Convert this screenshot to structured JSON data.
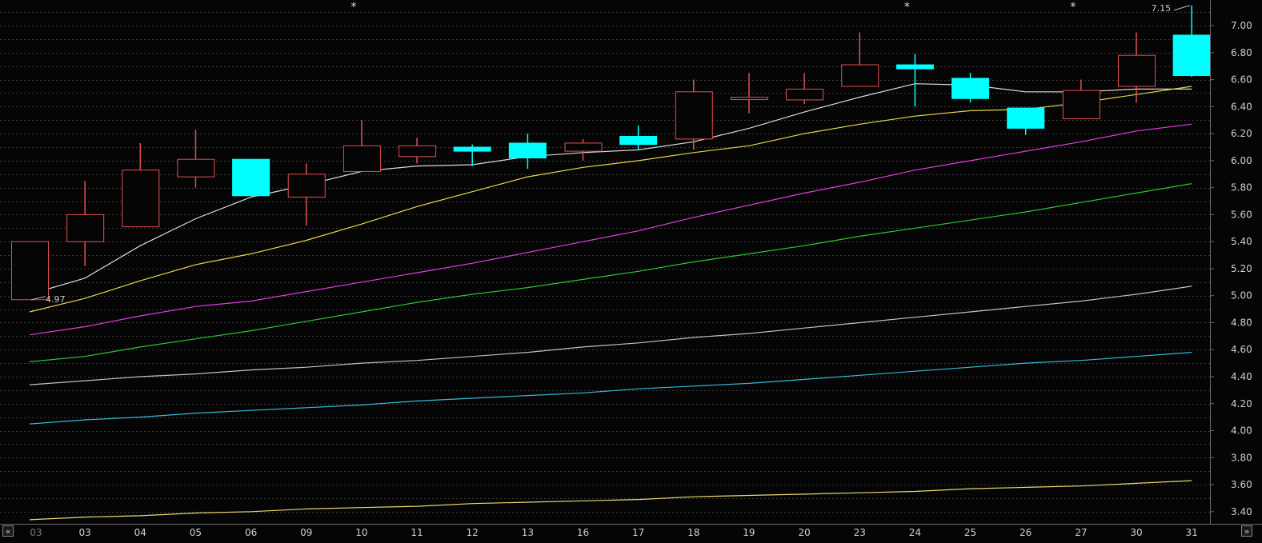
{
  "chart_data": {
    "type": "candlestick",
    "categories": [
      "03",
      "03",
      "04",
      "05",
      "06",
      "09",
      "10",
      "11",
      "12",
      "13",
      "16",
      "17",
      "18",
      "19",
      "20",
      "23",
      "24",
      "25",
      "26",
      "27",
      "30",
      "31"
    ],
    "first_label_dim": true,
    "y_ticks": [
      "3.40",
      "3.60",
      "3.80",
      "4.00",
      "4.20",
      "4.40",
      "4.60",
      "4.80",
      "5.00",
      "5.20",
      "5.40",
      "5.60",
      "5.80",
      "6.00",
      "6.20",
      "6.40",
      "6.60",
      "6.80",
      "7.00"
    ],
    "ylim": [
      3.31,
      7.19
    ],
    "grid": true,
    "candles": [
      {
        "o": 4.97,
        "h": 5.4,
        "l": 4.97,
        "c": 5.4
      },
      {
        "o": 5.4,
        "h": 5.85,
        "l": 5.22,
        "c": 5.6
      },
      {
        "o": 5.51,
        "h": 6.13,
        "l": 5.51,
        "c": 5.93
      },
      {
        "o": 5.88,
        "h": 6.23,
        "l": 5.8,
        "c": 6.01
      },
      {
        "o": 6.01,
        "h": 6.01,
        "l": 5.74,
        "c": 5.74
      },
      {
        "o": 5.73,
        "h": 5.98,
        "l": 5.52,
        "c": 5.9
      },
      {
        "o": 5.92,
        "h": 6.3,
        "l": 5.92,
        "c": 6.11
      },
      {
        "o": 6.03,
        "h": 6.17,
        "l": 5.98,
        "c": 6.11
      },
      {
        "o": 6.1,
        "h": 6.12,
        "l": 5.96,
        "c": 6.07
      },
      {
        "o": 6.13,
        "h": 6.2,
        "l": 5.94,
        "c": 6.02
      },
      {
        "o": 6.07,
        "h": 6.16,
        "l": 6.0,
        "c": 6.13
      },
      {
        "o": 6.18,
        "h": 6.26,
        "l": 6.08,
        "c": 6.12
      },
      {
        "o": 6.16,
        "h": 6.6,
        "l": 6.08,
        "c": 6.51
      },
      {
        "o": 6.47,
        "h": 6.65,
        "l": 6.35,
        "c": 6.47
      },
      {
        "o": 6.45,
        "h": 6.65,
        "l": 6.42,
        "c": 6.53
      },
      {
        "o": 6.55,
        "h": 6.95,
        "l": 6.55,
        "c": 6.71
      },
      {
        "o": 6.71,
        "h": 6.79,
        "l": 6.4,
        "c": 6.68
      },
      {
        "o": 6.61,
        "h": 6.65,
        "l": 6.43,
        "c": 6.46
      },
      {
        "o": 6.39,
        "h": 6.39,
        "l": 6.19,
        "c": 6.24
      },
      {
        "o": 6.31,
        "h": 6.6,
        "l": 6.31,
        "c": 6.52
      },
      {
        "o": 6.55,
        "h": 6.95,
        "l": 6.43,
        "c": 6.78
      },
      {
        "o": 6.93,
        "h": 7.15,
        "l": 6.62,
        "c": 6.63
      }
    ],
    "moving_averages": [
      {
        "color": "#d8d8d8",
        "values": [
          5.01,
          5.13,
          5.37,
          5.57,
          5.73,
          5.82,
          5.92,
          5.96,
          5.97,
          6.03,
          6.06,
          6.08,
          6.14,
          6.24,
          6.36,
          6.47,
          6.57,
          6.56,
          6.51,
          6.51,
          6.53,
          6.53
        ]
      },
      {
        "color": "#e6d64a",
        "values": [
          4.88,
          4.98,
          5.11,
          5.23,
          5.31,
          5.41,
          5.53,
          5.66,
          5.77,
          5.88,
          5.95,
          6.0,
          6.06,
          6.11,
          6.2,
          6.27,
          6.33,
          6.37,
          6.38,
          6.43,
          6.49,
          6.55
        ]
      },
      {
        "color": "#e03ce0",
        "values": [
          4.71,
          4.77,
          4.85,
          4.92,
          4.96,
          5.03,
          5.1,
          5.17,
          5.24,
          5.32,
          5.4,
          5.48,
          5.58,
          5.67,
          5.76,
          5.84,
          5.93,
          6.0,
          6.07,
          6.14,
          6.22,
          6.27
        ]
      },
      {
        "color": "#2ec42e",
        "values": [
          4.51,
          4.55,
          4.62,
          4.68,
          4.74,
          4.81,
          4.88,
          4.95,
          5.01,
          5.06,
          5.12,
          5.18,
          5.25,
          5.31,
          5.37,
          5.44,
          5.5,
          5.56,
          5.62,
          5.69,
          5.76,
          5.83
        ]
      },
      {
        "color": "#c0c0c0",
        "values": [
          4.34,
          4.37,
          4.4,
          4.42,
          4.45,
          4.47,
          4.5,
          4.52,
          4.55,
          4.58,
          4.62,
          4.65,
          4.69,
          4.72,
          4.76,
          4.8,
          4.84,
          4.88,
          4.92,
          4.96,
          5.01,
          5.07
        ]
      },
      {
        "color": "#36b8d8",
        "values": [
          4.05,
          4.08,
          4.1,
          4.13,
          4.15,
          4.17,
          4.19,
          4.22,
          4.24,
          4.26,
          4.28,
          4.31,
          4.33,
          4.35,
          4.38,
          4.41,
          4.44,
          4.47,
          4.5,
          4.52,
          4.55,
          4.58
        ]
      },
      {
        "color": "#e8d870",
        "values": [
          3.34,
          3.36,
          3.37,
          3.39,
          3.4,
          3.42,
          3.43,
          3.44,
          3.46,
          3.47,
          3.48,
          3.49,
          3.51,
          3.52,
          3.53,
          3.54,
          3.55,
          3.57,
          3.58,
          3.59,
          3.61,
          3.63
        ]
      }
    ],
    "annotations": [
      {
        "text": "4.97",
        "index": 0,
        "value": 4.97,
        "side": "right"
      },
      {
        "text": "7.15",
        "index": 21,
        "value": 7.15,
        "side": "left"
      }
    ],
    "event_markers": [
      {
        "text": "*",
        "index": 6
      },
      {
        "text": "*",
        "index": 16
      },
      {
        "text": "*",
        "index": 19
      }
    ],
    "colors": {
      "background": "#050505",
      "grid": "#3a3a3a",
      "up_candle": "#e05050",
      "down_candle": "#00ffff",
      "axis_text": "#d0d0d0"
    }
  },
  "nav": {
    "prev_icon": "«",
    "next_icon": "»"
  }
}
